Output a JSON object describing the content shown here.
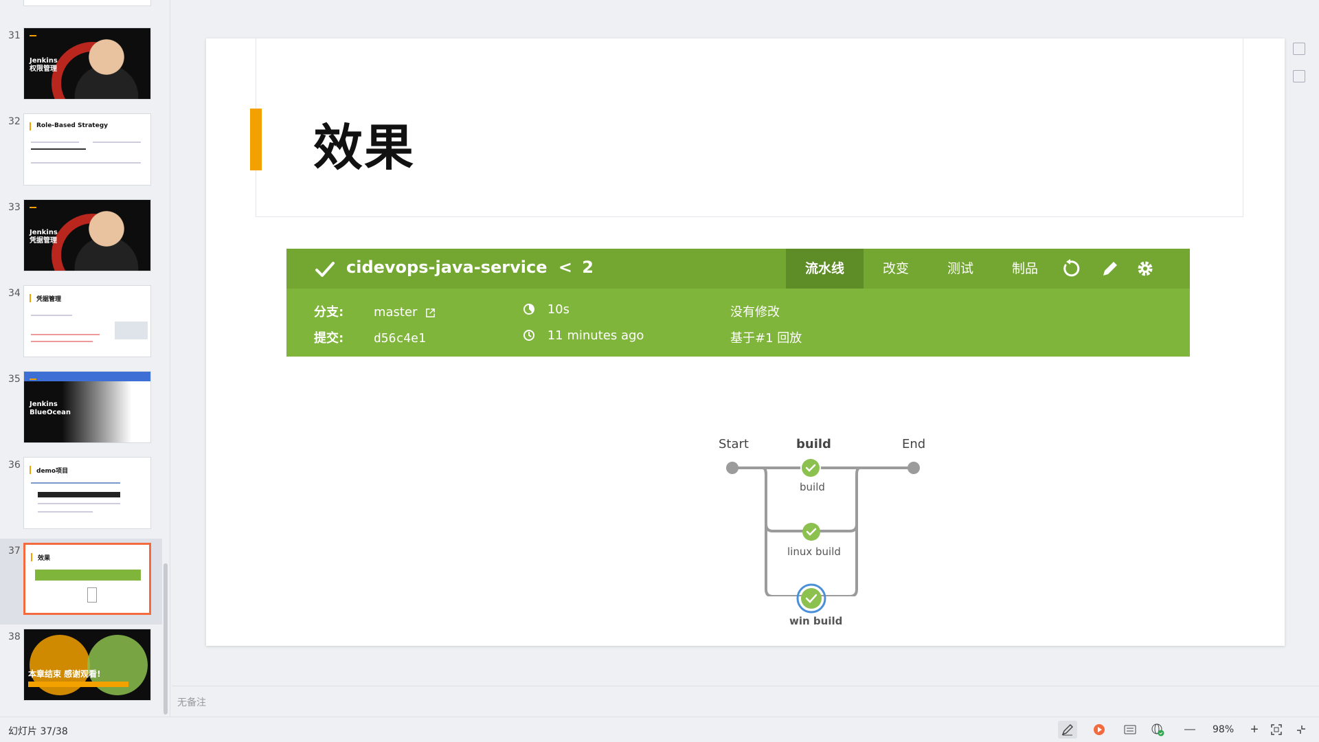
{
  "thumbnails": [
    {
      "num": "31",
      "title": "Jenkins\n权限管理",
      "style": "jenkins"
    },
    {
      "num": "32",
      "title": "Role-Based Strategy",
      "style": "doc"
    },
    {
      "num": "33",
      "title": "Jenkins\n凭据管理",
      "style": "jenkins"
    },
    {
      "num": "34",
      "title": "凭据管理",
      "style": "doc"
    },
    {
      "num": "35",
      "title": "Jenkins\nBlueOcean",
      "style": "gradient"
    },
    {
      "num": "36",
      "title": "demo项目",
      "style": "doc"
    },
    {
      "num": "37",
      "title": "效果",
      "style": "selected"
    },
    {
      "num": "38",
      "title": "本章结束 感谢观看!",
      "style": "end"
    }
  ],
  "slide": {
    "title": "效果"
  },
  "jenkins": {
    "name": "cidevops-java-service",
    "run_prefix": "<",
    "run_number": "2",
    "tabs": [
      "流水线",
      "改变",
      "测试",
      "制品"
    ],
    "active_tab": "流水线",
    "branch_label": "分支:",
    "branch_value": "master",
    "commit_label": "提交:",
    "commit_value": "d56c4e1",
    "duration": "10s",
    "time_ago": "11 minutes ago",
    "changes": "没有修改",
    "replay": "基于#1 回放",
    "status_color": "#7fb53a",
    "header_dark": "#74a731",
    "icons": [
      "check-icon",
      "chevron-left-icon",
      "replay-icon",
      "edit-icon",
      "gear-icon",
      "external-link-icon",
      "stopwatch-icon",
      "clock-icon"
    ]
  },
  "pipeline": {
    "start": "Start",
    "stage": "build",
    "end": "End",
    "nodes": [
      "build",
      "linux build",
      "win build"
    ],
    "success_color": "#8cc04f"
  },
  "notes": {
    "placeholder": "无备注"
  },
  "status": {
    "slide_counter": "幻灯片 37/38",
    "zoom": "98%",
    "minus": "—",
    "plus": "+"
  }
}
